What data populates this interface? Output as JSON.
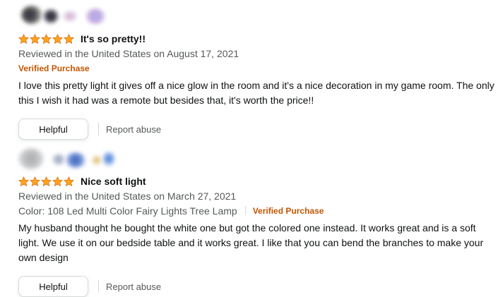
{
  "colors": {
    "star": "#ffa41c",
    "star_stroke": "#de7921",
    "verified": "#c45500",
    "secondary_text": "#565959",
    "primary_text": "#0f1111"
  },
  "reviews": [
    {
      "rating": 5,
      "title": "It's so pretty!!",
      "date": "Reviewed in the United States on August 17, 2021",
      "variant": "",
      "verified": "Verified Purchase",
      "body": "I love this pretty light it gives off a nice glow in the room and it's a nice decoration in my game room. The only this I wish it had was a remote but besides that, it's worth the price!!",
      "helpful_label": "Helpful",
      "report_label": "Report abuse"
    },
    {
      "rating": 5,
      "title": "Nice soft light",
      "date": "Reviewed in the United States on March 27, 2021",
      "variant": "Color: 108 Led Multi Color Fairy Lights Tree Lamp",
      "verified": "Verified Purchase",
      "body": "My husband thought he bought the white one but got the colored one instead. It works great and is a soft light. We use it on our bedside table and it works great. I like that you can bend the branches to make your own design",
      "helpful_label": "Helpful",
      "report_label": "Report abuse"
    }
  ]
}
